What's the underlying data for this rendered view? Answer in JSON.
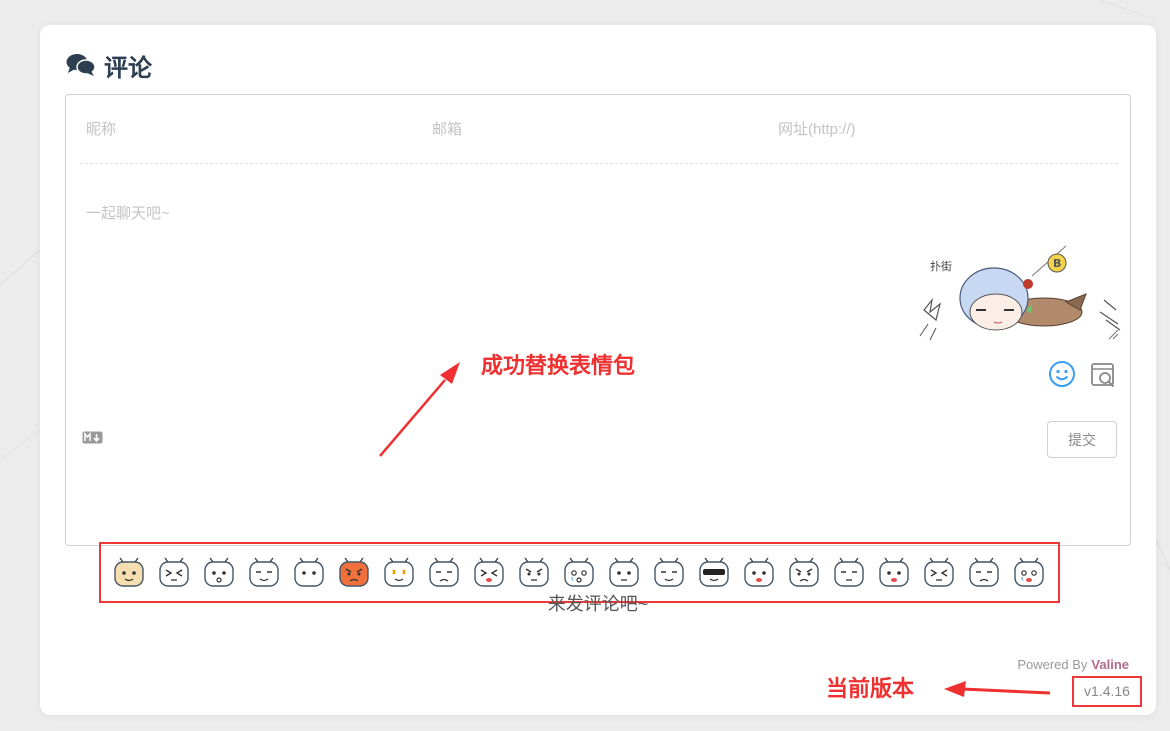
{
  "comment_section": {
    "title": "评论",
    "icon": "comments-icon"
  },
  "form": {
    "nickname_placeholder": "昵称",
    "email_placeholder": "邮箱",
    "website_placeholder": "网址(http://)",
    "textarea_placeholder": "一起聊天吧~",
    "submit_label": "提交",
    "markdown_icon": "markdown-icon",
    "emoji_button_icon": "emoji-icon",
    "preview_button_icon": "preview-icon"
  },
  "emoji_picker": {
    "count": 21,
    "accent": "#ee3737"
  },
  "empty_message": "来发评论吧~",
  "footer": {
    "powered_by": "Powered By",
    "brand": "Valine",
    "version": "v1.4.16"
  },
  "annotations": {
    "emoji_note": "成功替换表情包",
    "version_note": "当前版本",
    "color": "#ee3030"
  }
}
